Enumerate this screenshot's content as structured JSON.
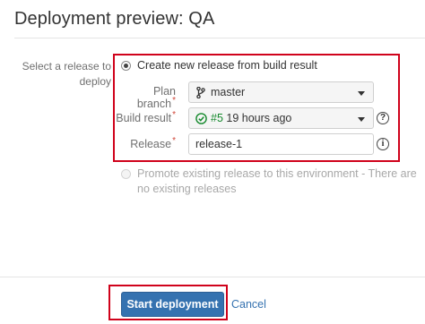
{
  "page": {
    "title": "Deployment preview: QA"
  },
  "release": {
    "section_label": "Select a release to deploy",
    "create_option": {
      "label": "Create new release from build result",
      "selected": true
    },
    "plan_branch": {
      "label": "Plan branch",
      "value": "master"
    },
    "build_result": {
      "label": "Build result",
      "build_number": "#5",
      "age": "19 hours ago"
    },
    "release_name": {
      "label": "Release",
      "value": "release-1"
    },
    "required_marker": "*",
    "promote_option": {
      "label": "Promote existing release to this environment - There are no existing releases",
      "enabled": false
    }
  },
  "icons": {
    "help": "?",
    "info": "i"
  },
  "footer": {
    "start_label": "Start deployment",
    "cancel_label": "Cancel"
  },
  "colors": {
    "primary_button": "#3572b0",
    "highlight": "#d0021b",
    "success": "#14892c",
    "required": "#d04437"
  }
}
